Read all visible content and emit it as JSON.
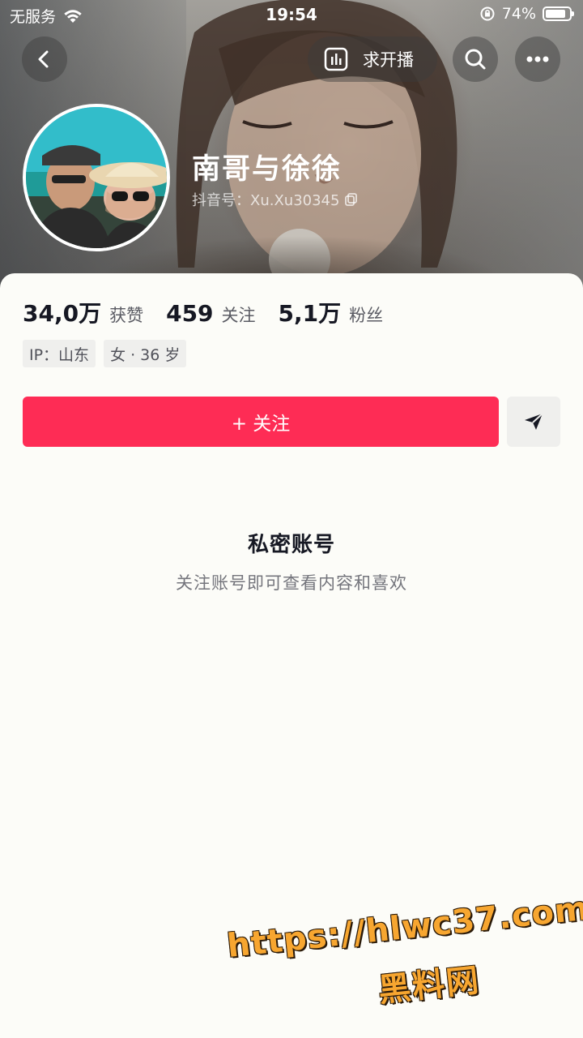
{
  "status_bar": {
    "carrier": "无服务",
    "time": "19:54",
    "battery": "74%",
    "battery_level": 0.74
  },
  "header": {
    "live_request_label": "求开播"
  },
  "profile": {
    "name": "南哥与徐徐",
    "douyin_id": "抖音号：Xu.Xu30345"
  },
  "stats": [
    {
      "value": "34,0万",
      "label": "获赞"
    },
    {
      "value": "459",
      "label": "关注"
    },
    {
      "value": "5,1万",
      "label": "粉丝"
    }
  ],
  "tags": [
    "IP：山东",
    "女 · 36 岁"
  ],
  "actions": {
    "follow_label": "+ 关注"
  },
  "private_notice": {
    "title": "私密账号",
    "subtitle": "关注账号即可查看内容和喜欢"
  },
  "watermark": {
    "url": "https://hlwc37.com",
    "site": "黑料网"
  },
  "colors": {
    "accent": "#fe2c55",
    "card_bg": "#fcfcf8",
    "text_primary": "#161823",
    "text_secondary": "#74757c"
  },
  "icons": [
    "back-icon",
    "chart-icon",
    "search-icon",
    "more-icon",
    "copy-icon",
    "share-send-icon",
    "wifi-icon",
    "lock-rotation-icon"
  ]
}
